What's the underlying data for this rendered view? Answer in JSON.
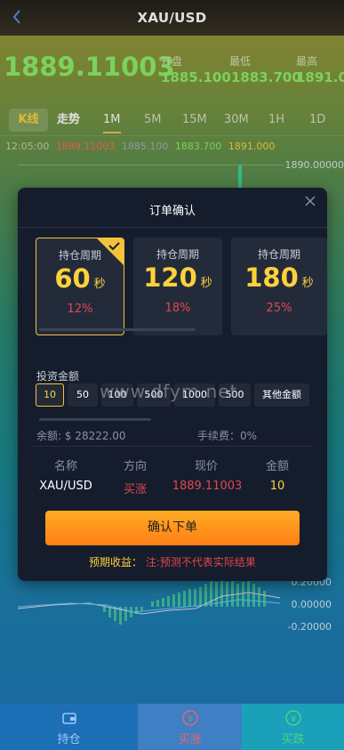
{
  "header": {
    "title": "XAU/USD"
  },
  "price": {
    "current": "1889.11003",
    "stats": [
      {
        "label": "开盘",
        "value": "1885.100"
      },
      {
        "label": "最低",
        "value": "1883.700"
      },
      {
        "label": "最高",
        "value": "1891.0"
      }
    ]
  },
  "tabs": {
    "kline": "K线",
    "trend": "走势",
    "timeframes": [
      "1M",
      "5M",
      "15M",
      "30M",
      "1H",
      "1D"
    ],
    "active_timeframe": "1M"
  },
  "ohlc_line": {
    "time": "12:05:00",
    "close": "1889.11003",
    "open": "1885.100",
    "low": "1883.700",
    "high": "1891.000"
  },
  "chart_axis": {
    "top": "1890.00000",
    "macd": [
      "0.20000",
      "0.00000",
      "-0.20000"
    ]
  },
  "modal": {
    "title": "订单确认",
    "periods": [
      {
        "label": "持仓周期",
        "value": "60",
        "unit": "秒",
        "pct": "12%"
      },
      {
        "label": "持仓周期",
        "value": "120",
        "unit": "秒",
        "pct": "18%"
      },
      {
        "label": "持仓周期",
        "value": "180",
        "unit": "秒",
        "pct": "25%"
      }
    ],
    "selected_period": 0,
    "amount_label": "投资金额",
    "amounts": [
      "10",
      "50",
      "100",
      "500",
      "1000",
      "500",
      "其他金额"
    ],
    "selected_amount": 0,
    "balance": "余额: $ 28222.00",
    "fee": "手续费：0%",
    "order_headers": [
      "名称",
      "方向",
      "现价",
      "金额"
    ],
    "order_values": {
      "name": "XAU/USD",
      "direction": "买涨",
      "price": "1889.11003",
      "amount": "10"
    },
    "confirm_label": "确认下单",
    "expected_label": "预期收益：",
    "expected_note": "注:预测不代表实际结果"
  },
  "watermark": "www.dfym.net",
  "bottom_bar": {
    "hold": "持仓",
    "buy_up": "买涨",
    "buy_down": "买跌"
  },
  "colors": {
    "accent_gold": "#ffd13a",
    "up_red": "#e0484b",
    "price_green": "#8cf06a",
    "confirm_orange": "#ff8c1a"
  }
}
